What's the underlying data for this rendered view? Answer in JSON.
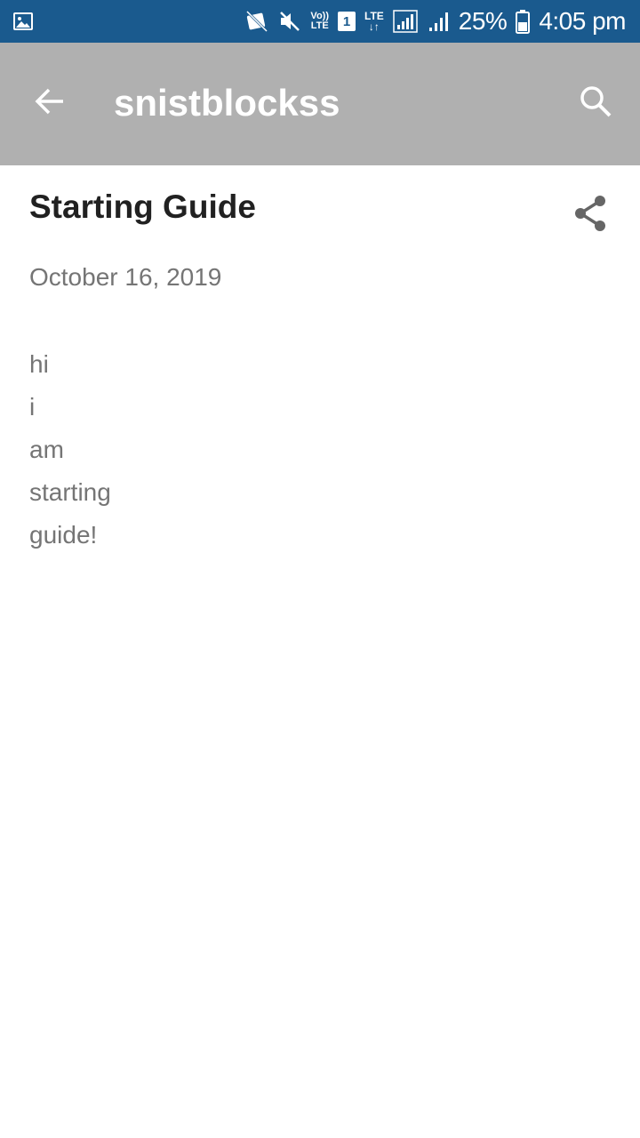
{
  "status_bar": {
    "left_icon": "image-notification-icon",
    "volte_top": "Vo))",
    "volte_bottom": "LTE",
    "sim": "1",
    "lte": "LTE",
    "lte_arrows": "↓↑",
    "battery": "25%",
    "time": "4:05 pm",
    "background": "#1a5a8e"
  },
  "app_bar": {
    "title": "snistblockss",
    "back_icon": "arrow-back-icon",
    "search_icon": "search-icon",
    "background": "#b0b0b0"
  },
  "post": {
    "title": "Starting Guide",
    "share_icon": "share-icon",
    "date": "October 16, 2019",
    "body_lines": [
      "hi",
      "i",
      "am",
      "starting",
      "guide!"
    ]
  }
}
